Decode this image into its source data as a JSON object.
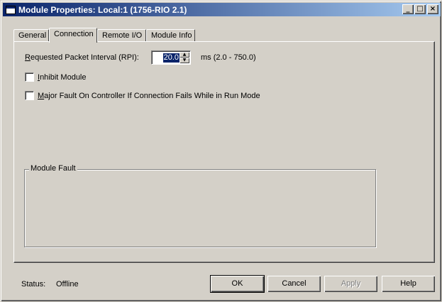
{
  "window": {
    "title": "Module Properties: Local:1 (1756-RIO 2.1)",
    "buttons": {
      "minimize": "_",
      "maximize": "□",
      "close": "×"
    }
  },
  "tabs": [
    {
      "label": "General",
      "active": false
    },
    {
      "label": "Connection",
      "active": true
    },
    {
      "label": "Remote I/O",
      "active": false
    },
    {
      "label": "Module Info",
      "active": false
    }
  ],
  "connection": {
    "rpi_label_accel": "R",
    "rpi_label_rest": "equested Packet Interval (RPI):",
    "rpi_value": "20.0",
    "rpi_range": "ms (2.0 - 750.0)",
    "inhibit_accel": "I",
    "inhibit_rest": "nhibit Module",
    "inhibit_checked": false,
    "major_fault_accel": "M",
    "major_fault_rest": "ajor Fault On Controller If Connection Fails While in Run Mode",
    "major_fault_checked": false,
    "module_fault_label": "Module Fault"
  },
  "status": {
    "label": "Status:",
    "value": "Offline"
  },
  "dialog_buttons": {
    "ok": "OK",
    "cancel": "Cancel",
    "apply": "Apply",
    "help": "Help"
  }
}
